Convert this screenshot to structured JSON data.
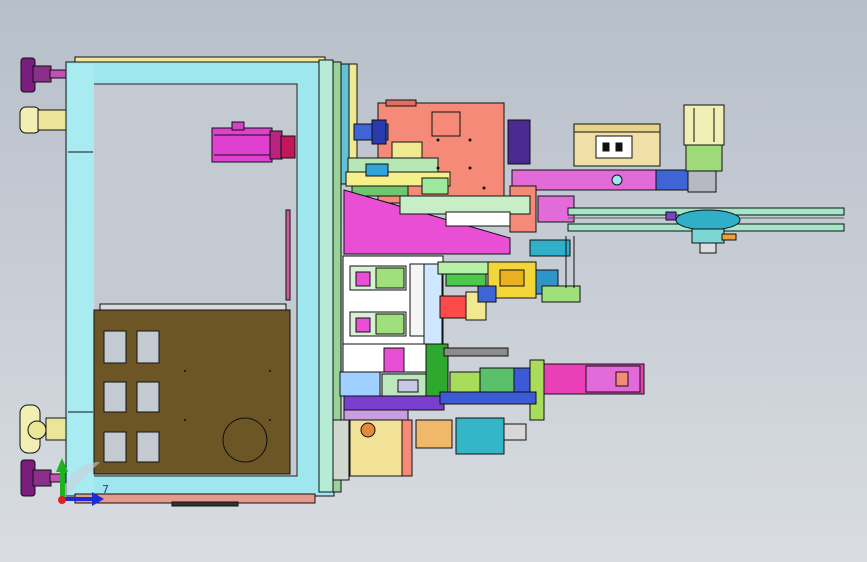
{
  "viewport": {
    "background_top": "#b7bfca",
    "background_bottom": "#d9dde2"
  },
  "triad": {
    "axis_label": "7",
    "colors": {
      "x": "#1a2dd6",
      "y": "#1eb31e",
      "z": "#e0201a"
    }
  },
  "palette": {
    "frame": "#9fe7ee",
    "panel": "#6d5626",
    "motor": "#e040d0",
    "plate": "#f58a78",
    "slide": "#e36ad9",
    "feet": "#7a1d7e",
    "wheel": "#f1efb4",
    "belt_plate": "#a3e6c9",
    "outline": "#111111"
  }
}
